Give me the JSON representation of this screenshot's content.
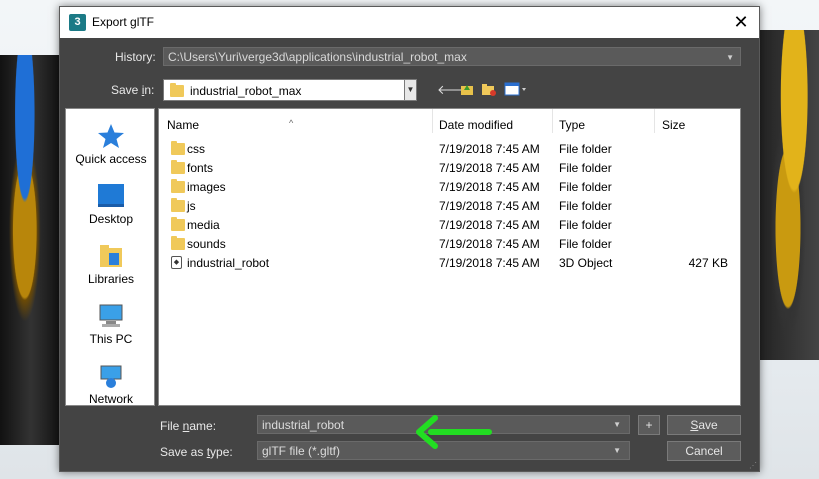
{
  "window": {
    "title": "Export glTF",
    "app_icon_label": "3",
    "close_glyph": "✕"
  },
  "history": {
    "label_pre": "History:",
    "path": "C:\\Users\\Yuri\\verge3d\\applications\\industrial_robot_max"
  },
  "save_in": {
    "label_pre": "Save ",
    "label_u": "i",
    "label_post": "n:",
    "value": "industrial_robot_max"
  },
  "places": [
    {
      "label": "Quick access",
      "icon": "star-icon"
    },
    {
      "label": "Desktop",
      "icon": "desktop-icon"
    },
    {
      "label": "Libraries",
      "icon": "libraries-icon"
    },
    {
      "label": "This PC",
      "icon": "computer-icon"
    },
    {
      "label": "Network",
      "icon": "network-icon"
    }
  ],
  "columns": {
    "name": "Name",
    "date": "Date modified",
    "type": "Type",
    "size": "Size"
  },
  "files": [
    {
      "name": "css",
      "date": "7/19/2018 7:45 AM",
      "type": "File folder",
      "size": "",
      "icon": "folder-icon"
    },
    {
      "name": "fonts",
      "date": "7/19/2018 7:45 AM",
      "type": "File folder",
      "size": "",
      "icon": "folder-icon"
    },
    {
      "name": "images",
      "date": "7/19/2018 7:45 AM",
      "type": "File folder",
      "size": "",
      "icon": "folder-icon"
    },
    {
      "name": "js",
      "date": "7/19/2018 7:45 AM",
      "type": "File folder",
      "size": "",
      "icon": "folder-icon"
    },
    {
      "name": "media",
      "date": "7/19/2018 7:45 AM",
      "type": "File folder",
      "size": "",
      "icon": "folder-icon"
    },
    {
      "name": "sounds",
      "date": "7/19/2018 7:45 AM",
      "type": "File folder",
      "size": "",
      "icon": "folder-icon"
    },
    {
      "name": "industrial_robot",
      "date": "7/19/2018 7:45 AM",
      "type": "3D Object",
      "size": "427 KB",
      "icon": "3d-object-icon"
    }
  ],
  "file_name": {
    "label_pre": "File ",
    "label_u": "n",
    "label_post": "ame:",
    "value": "industrial_robot"
  },
  "save_type": {
    "label_pre": "Save as ",
    "label_u": "t",
    "label_post": "ype:",
    "value": "glTF file (*.gltf)"
  },
  "buttons": {
    "plus": "+",
    "save_u": "S",
    "save_post": "ave",
    "cancel": "Cancel"
  },
  "colors": {
    "dialog_bg": "#444444",
    "arrow": "#22dd22"
  }
}
